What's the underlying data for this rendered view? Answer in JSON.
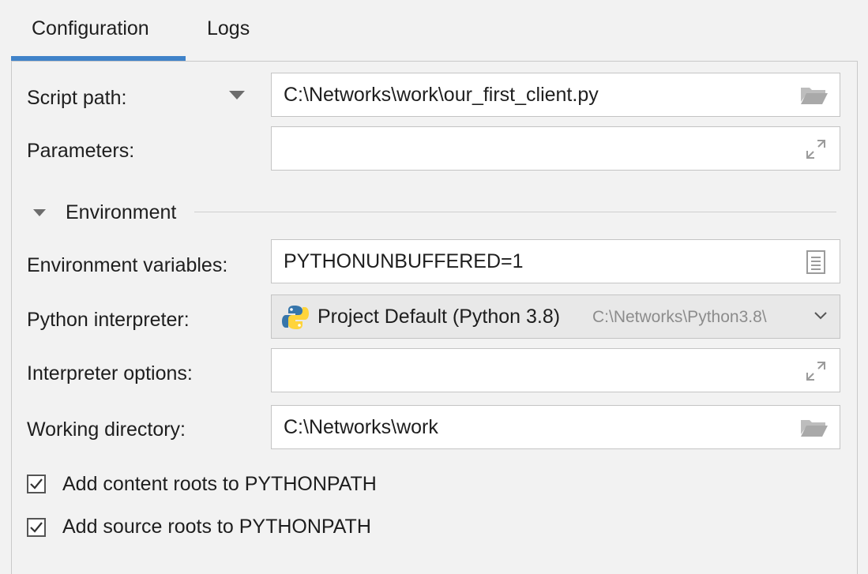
{
  "tabs": {
    "configuration": "Configuration",
    "logs": "Logs"
  },
  "script_path": {
    "label": "Script path:",
    "value": "C:\\Networks\\work\\our_first_client.py"
  },
  "parameters": {
    "label": "Parameters:",
    "value": ""
  },
  "environment_section": {
    "title": "Environment"
  },
  "environment_variables": {
    "label": "Environment variables:",
    "value": "PYTHONUNBUFFERED=1"
  },
  "python_interpreter": {
    "label": "Python interpreter:",
    "value": "Project Default (Python 3.8)",
    "path_hint": "C:\\Networks\\Python3.8\\"
  },
  "interpreter_options": {
    "label": "Interpreter options:",
    "value": ""
  },
  "working_directory": {
    "label": "Working directory:",
    "value": "C:\\Networks\\work"
  },
  "checkboxes": [
    {
      "label": "Add content roots to PYTHONPATH",
      "checked": true
    },
    {
      "label": "Add source roots to PYTHONPATH",
      "checked": true
    }
  ],
  "colors": {
    "accent": "#4083c9",
    "background": "#f2f2f2",
    "python_blue": "#3776ab",
    "python_yellow": "#ffd43b"
  }
}
